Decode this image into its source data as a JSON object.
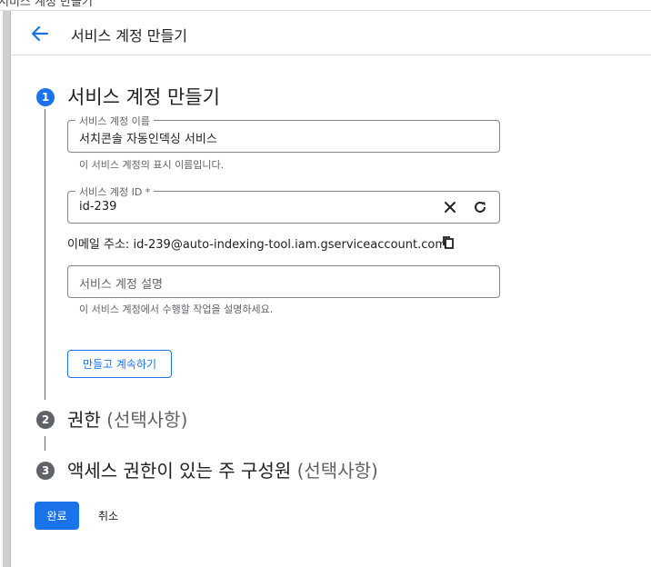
{
  "window": {
    "title": "서비스 계정 만들기"
  },
  "header": {
    "back_icon": "arrow-left-icon",
    "title": "서비스 계정 만들기"
  },
  "steps": [
    {
      "number": "1",
      "title": "서비스 계정 만들기",
      "optional": "",
      "active": true
    },
    {
      "number": "2",
      "title": "권한",
      "optional": "(선택사항)",
      "active": false
    },
    {
      "number": "3",
      "title": "액세스 권한이 있는 주 구성원",
      "optional": "(선택사항)",
      "active": false
    }
  ],
  "form": {
    "name_field": {
      "label": "서비스 계정 이름",
      "value": "서치콘솔 자동인덱싱 서비스",
      "hint": "이 서비스 계정의 표시 이름입니다."
    },
    "id_field": {
      "label": "서비스 계정 ID *",
      "value": "id-239",
      "clear_icon": "close-icon",
      "refresh_icon": "refresh-icon"
    },
    "email": {
      "label": "이메일 주소:",
      "value": "id-239@auto-indexing-tool.iam.gserviceaccount.com",
      "copy_icon": "copy-icon"
    },
    "description_field": {
      "placeholder": "서비스 계정 설명",
      "value": "",
      "hint": "이 서비스 계정에서 수행할 작업을 설명하세요."
    },
    "create_continue_label": "만들고 계속하기"
  },
  "footer": {
    "done_label": "완료",
    "cancel_label": "취소"
  },
  "colors": {
    "accent": "#1a73e8",
    "text": "#202124",
    "muted": "#5f6368",
    "border": "#80868b"
  }
}
